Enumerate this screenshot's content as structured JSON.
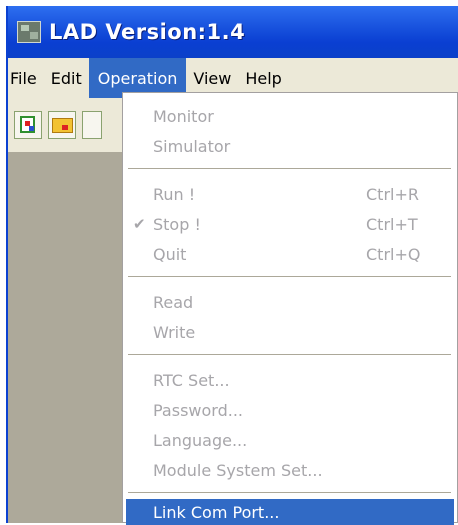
{
  "window": {
    "title": "LAD Version:1.4"
  },
  "menubar": {
    "items": [
      "File",
      "Edit",
      "Operation",
      "View",
      "Help"
    ],
    "active": "Operation"
  },
  "toolbar": {
    "buttons": [
      "new-icon",
      "open-folder-icon",
      "partial-toolbar-button"
    ]
  },
  "operation_menu": {
    "monitor": "Monitor",
    "simulator": "Simulator",
    "run": "Run !",
    "run_shortcut": "Ctrl+R",
    "stop": "Stop !",
    "stop_shortcut": "Ctrl+T",
    "stop_checked": true,
    "quit": "Quit",
    "quit_shortcut": "Ctrl+Q",
    "read": "Read",
    "write": "Write",
    "rtc_set": "RTC Set...",
    "password": "Password...",
    "language": "Language...",
    "module_system_set": "Module System Set...",
    "link_com_port": "Link Com Port..."
  },
  "colors": {
    "titlebar": "#0b40c9",
    "menu_highlight": "#316ac5",
    "disabled_text": "#a7a6aa",
    "workarea": "#ada99a"
  }
}
